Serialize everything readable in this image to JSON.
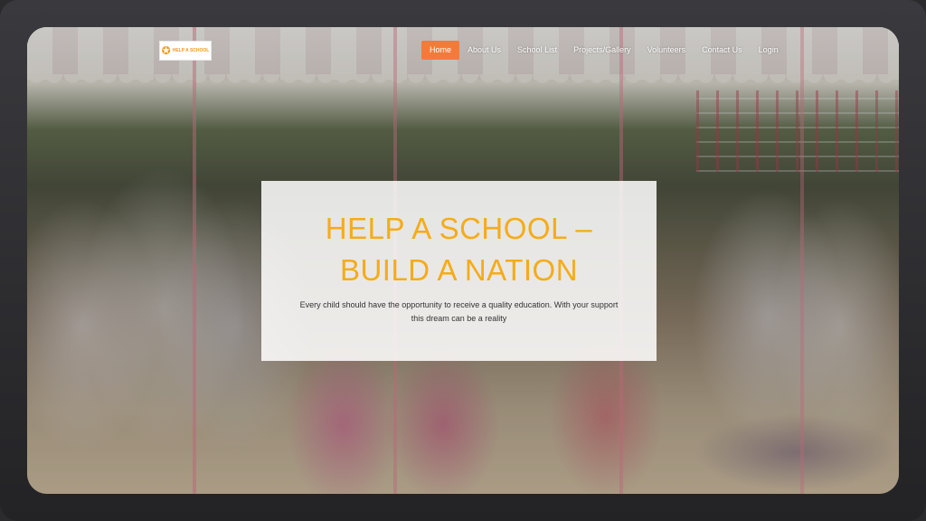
{
  "logo": {
    "text": "HELP A SCHOOL",
    "mark": "✪"
  },
  "nav": {
    "items": [
      {
        "label": "Home",
        "active": true
      },
      {
        "label": "About Us",
        "active": false
      },
      {
        "label": "School List",
        "active": false
      },
      {
        "label": "Projects/Gallery",
        "active": false
      },
      {
        "label": "Volunteers",
        "active": false
      },
      {
        "label": "Contact Us",
        "active": false
      },
      {
        "label": "Login",
        "active": false
      }
    ]
  },
  "hero": {
    "title_line1": "HELP A SCHOOL –",
    "title_line2": "BUILD A NATION",
    "subtitle": "Every child should have the opportunity to receive a quality education. With your support this dream can be a reality"
  },
  "colors": {
    "accent": "#f47a3b",
    "title": "#f6ab18",
    "card": "#ffffff"
  }
}
